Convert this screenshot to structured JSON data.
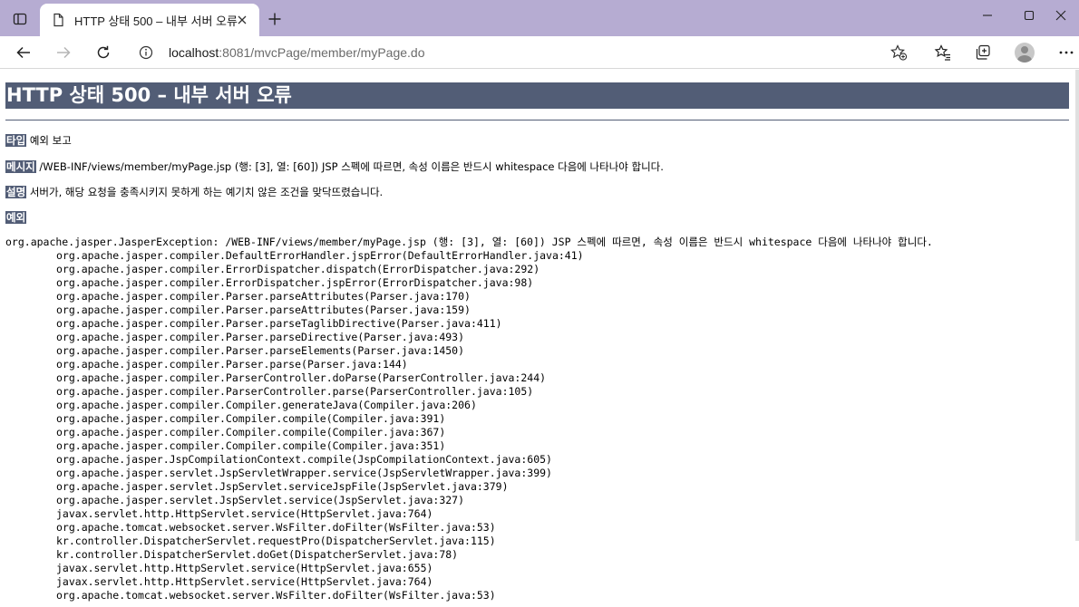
{
  "browser": {
    "tab": {
      "title": "HTTP 상태 500 – 내부 서버 오류",
      "close_icon": "close-icon"
    },
    "address": {
      "host": "localhost",
      "rest": ":8081/mvcPage/member/myPage.do"
    },
    "colors": {
      "titlebar": "#b6acd2",
      "heading_bg": "#525d76"
    }
  },
  "error": {
    "title": "HTTP 상태 500 – 내부 서버 오류",
    "type_label": "타입",
    "type_value": "예외 보고",
    "message_label": "메시지",
    "message_value": "/WEB-INF/views/member/myPage.jsp (행: [3], 열: [60]) JSP 스펙에 따르면, 속성 이름은 반드시 whitespace 다음에 나타나야 합니다.",
    "description_label": "설명",
    "description_value": "서버가, 해당 요청을 충족시키지 못하게 하는 예기치 않은 조건을 맞닥뜨렸습니다.",
    "exception_label": "예외",
    "trace_head": "org.apache.jasper.JasperException: /WEB-INF/views/member/myPage.jsp (행: [3], 열: [60]) JSP 스펙에 따르면, 속성 이름은 반드시 whitespace 다음에 나타나야 합니다.",
    "trace": [
      "org.apache.jasper.compiler.DefaultErrorHandler.jspError(DefaultErrorHandler.java:41)",
      "org.apache.jasper.compiler.ErrorDispatcher.dispatch(ErrorDispatcher.java:292)",
      "org.apache.jasper.compiler.ErrorDispatcher.jspError(ErrorDispatcher.java:98)",
      "org.apache.jasper.compiler.Parser.parseAttributes(Parser.java:170)",
      "org.apache.jasper.compiler.Parser.parseAttributes(Parser.java:159)",
      "org.apache.jasper.compiler.Parser.parseTaglibDirective(Parser.java:411)",
      "org.apache.jasper.compiler.Parser.parseDirective(Parser.java:493)",
      "org.apache.jasper.compiler.Parser.parseElements(Parser.java:1450)",
      "org.apache.jasper.compiler.Parser.parse(Parser.java:144)",
      "org.apache.jasper.compiler.ParserController.doParse(ParserController.java:244)",
      "org.apache.jasper.compiler.ParserController.parse(ParserController.java:105)",
      "org.apache.jasper.compiler.Compiler.generateJava(Compiler.java:206)",
      "org.apache.jasper.compiler.Compiler.compile(Compiler.java:391)",
      "org.apache.jasper.compiler.Compiler.compile(Compiler.java:367)",
      "org.apache.jasper.compiler.Compiler.compile(Compiler.java:351)",
      "org.apache.jasper.JspCompilationContext.compile(JspCompilationContext.java:605)",
      "org.apache.jasper.servlet.JspServletWrapper.service(JspServletWrapper.java:399)",
      "org.apache.jasper.servlet.JspServlet.serviceJspFile(JspServlet.java:379)",
      "org.apache.jasper.servlet.JspServlet.service(JspServlet.java:327)",
      "javax.servlet.http.HttpServlet.service(HttpServlet.java:764)",
      "org.apache.tomcat.websocket.server.WsFilter.doFilter(WsFilter.java:53)",
      "kr.controller.DispatcherServlet.requestPro(DispatcherServlet.java:115)",
      "kr.controller.DispatcherServlet.doGet(DispatcherServlet.java:78)",
      "javax.servlet.http.HttpServlet.service(HttpServlet.java:655)",
      "javax.servlet.http.HttpServlet.service(HttpServlet.java:764)",
      "org.apache.tomcat.websocket.server.WsFilter.doFilter(WsFilter.java:53)"
    ]
  }
}
